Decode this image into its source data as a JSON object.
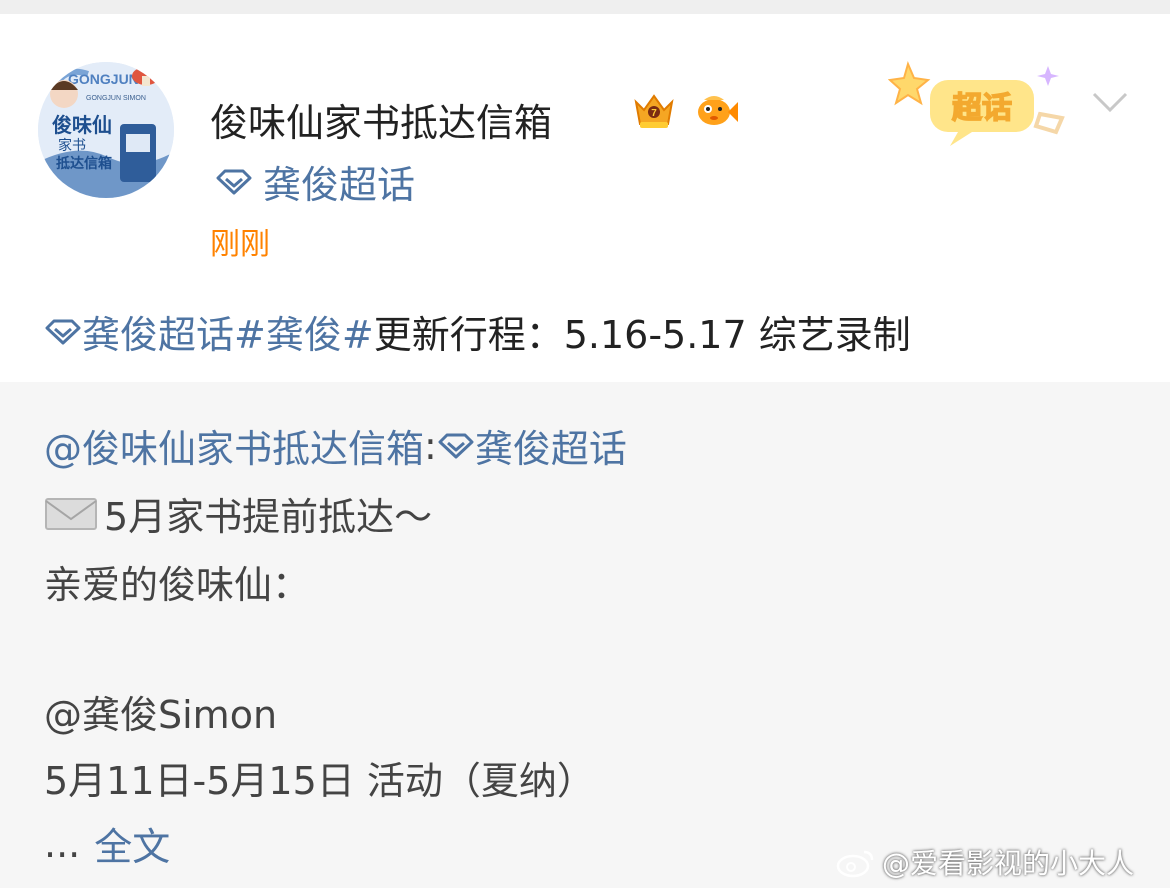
{
  "post": {
    "username": "俊味仙家书抵达信箱",
    "super_topic": "龚俊超话",
    "timestamp": "刚刚",
    "chaohua_badge": "超话",
    "content": {
      "tag_supertopic": "龚俊超话",
      "hashtag": "#龚俊#",
      "text": " 更新行程：5.16-5.17 综艺录制"
    }
  },
  "repost": {
    "author": "@俊味仙家书抵达信箱",
    "colon": ":",
    "supertopic": "龚俊超话",
    "line1": "5月家书提前抵达～",
    "line2": "亲爱的俊味仙：",
    "mention": "@龚俊Simon",
    "line4": "5月11日-5月15日  活动（夏纳）",
    "ellipsis": "...",
    "full_text_link": "全文"
  },
  "avatar": {
    "title_line1": "俊味仙",
    "title_line2": "家书",
    "title_line3": "抵达信箱",
    "arc_text": "GONGJUN",
    "sub_text": "GONGJUN SIMON"
  },
  "watermark": "@爱看影视的小大人",
  "colors": {
    "link": "#4e74a3",
    "timestamp": "#ff8200",
    "repost_bg": "#f6f6f6"
  },
  "icons": [
    "diamond-supertopic-icon",
    "crown-badge-icon",
    "fish-badge-icon",
    "chevron-down-icon",
    "envelope-icon",
    "weibo-logo-icon"
  ]
}
